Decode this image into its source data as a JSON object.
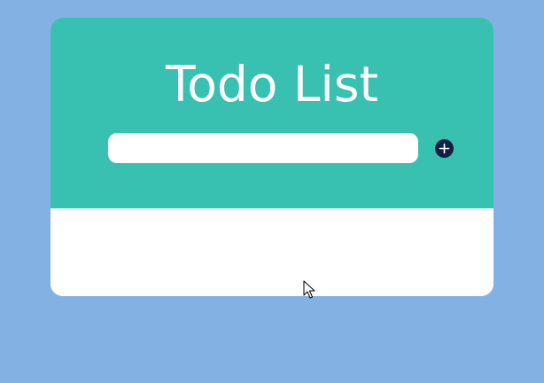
{
  "app": {
    "title": "Todo List"
  },
  "input": {
    "value": "",
    "placeholder": ""
  },
  "add_button": {
    "icon": "plus-circle-icon"
  },
  "todos": [],
  "colors": {
    "background": "#84b1e4",
    "header": "#38c0b0",
    "card_body": "#ffffff",
    "title_text": "#ffffff",
    "add_button": "#0e2247"
  }
}
